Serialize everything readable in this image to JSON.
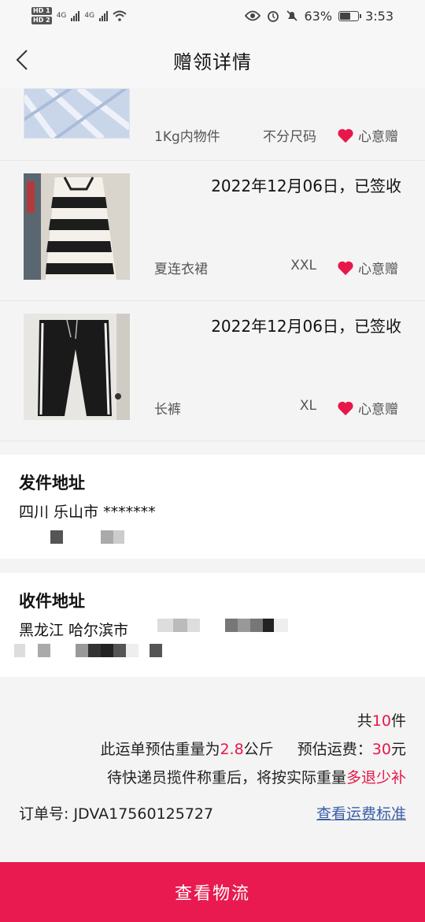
{
  "status_bar": {
    "network_left": [
      "HD 1",
      "HD 2"
    ],
    "signal_label": "4G",
    "battery": "63%",
    "battery_level": 0.63,
    "time": "3:53",
    "icons": [
      "eye-icon",
      "alarm-icon",
      "mute-icon",
      "battery-icon"
    ]
  },
  "nav": {
    "title": "赠领详情",
    "back_icon": "chevron-left-icon"
  },
  "items": [
    {
      "date": "",
      "name": "1Kg内物件",
      "size": "不分尺码",
      "tag": "心意赠"
    },
    {
      "date": "2022年12月06日，已签收",
      "name": "夏连衣裙",
      "size": "XXL",
      "tag": "心意赠"
    },
    {
      "date": "2022年12月06日，已签收",
      "name": "长裤",
      "size": "XL",
      "tag": "心意赠"
    }
  ],
  "sender": {
    "label": "发件地址",
    "address": "四川 乐山市 *******"
  },
  "receiver": {
    "label": "收件地址",
    "address": "黑龙江 哈尔滨市"
  },
  "summary": {
    "count_prefix": "共",
    "count": "10",
    "count_suffix": "件",
    "weight_prefix": "此运单预估重量为",
    "weight": "2.8",
    "weight_unit": "公斤",
    "fee_prefix": "预估运费：",
    "fee": "30",
    "fee_unit": "元",
    "note_prefix": "待快递员揽件称重后，将按实际重量",
    "note_highlight": "多退少补",
    "order_label": "订单号:",
    "order_no": "JDVA17560125727",
    "fee_standard_link": "查看运费标准"
  },
  "bottom_button": "查看物流",
  "colors": {
    "accent": "#e81a4f",
    "link": "#3a5ea6"
  }
}
